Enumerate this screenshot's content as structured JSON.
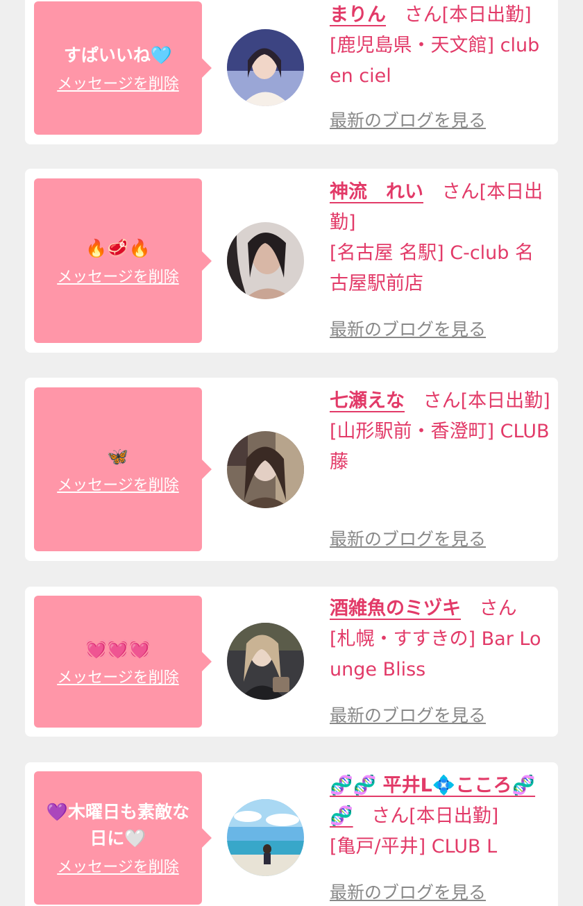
{
  "delete_label": "メッセージを削除",
  "blog_label": "最新のブログを見る",
  "cards": [
    {
      "message": "すぱいいね🩵",
      "name": "まりん",
      "suffix": "さん[本日出勤]",
      "shop": "[鹿児島県・天文館] club en ciel"
    },
    {
      "message": "🔥🥩🔥",
      "name": "神流　れい",
      "suffix": "さん[本日出勤]",
      "shop": "[名古屋 名駅] C-club 名古屋駅前店"
    },
    {
      "message": "🦋",
      "name": "七瀬えな",
      "suffix": "さん[本日出勤]",
      "shop": "[山形駅前・香澄町] CLUB 藤"
    },
    {
      "message": "💓💓💓",
      "name": "酒雑魚のミヅキ",
      "suffix": "さん",
      "shop": "[札幌・すすきの] Bar Lounge Bliss"
    },
    {
      "message": "💜木曜日も素敵な日に🤍",
      "name": "🧬🧬 平井L💠こころ🧬🧬",
      "suffix": "さん[本日出勤]",
      "shop": "[亀戸/平井] CLUB L"
    }
  ],
  "colors": {
    "bubble": "#ff96a8",
    "accent": "#e23a68",
    "link_gray": "#888888",
    "background": "#efefef"
  }
}
